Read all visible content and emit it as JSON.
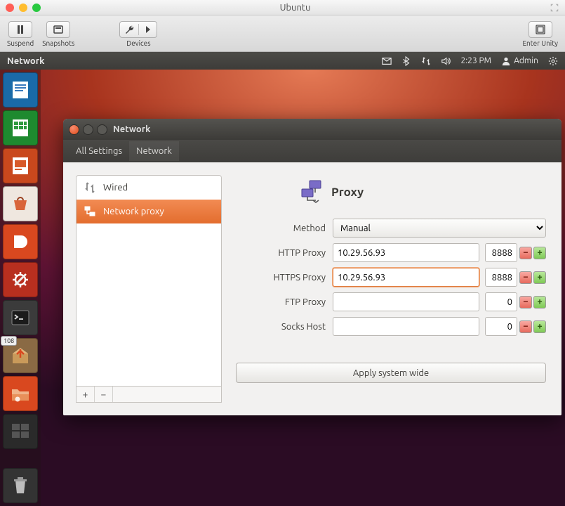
{
  "mac": {
    "title": "Ubuntu",
    "tools": {
      "suspend": "Suspend",
      "snapshots": "Snapshots",
      "devices": "Devices",
      "enter_unity": "Enter Unity"
    }
  },
  "ubuntu_panel": {
    "title": "Network",
    "time": "2:23 PM",
    "user": "Admin"
  },
  "launcher": {
    "badge": "108"
  },
  "window": {
    "title": "Network",
    "breadcrumb": {
      "all_settings": "All Settings",
      "network": "Network"
    }
  },
  "sidebar": {
    "items": [
      {
        "label": "Wired"
      },
      {
        "label": "Network proxy"
      }
    ]
  },
  "detail": {
    "heading": "Proxy",
    "method_label": "Method",
    "method_value": "Manual",
    "rows": [
      {
        "label": "HTTP Proxy",
        "host": "10.29.56.93",
        "port": "8888"
      },
      {
        "label": "HTTPS Proxy",
        "host": "10.29.56.93",
        "port": "8888"
      },
      {
        "label": "FTP Proxy",
        "host": "",
        "port": "0"
      },
      {
        "label": "Socks Host",
        "host": "",
        "port": "0"
      }
    ],
    "apply": "Apply system wide"
  }
}
